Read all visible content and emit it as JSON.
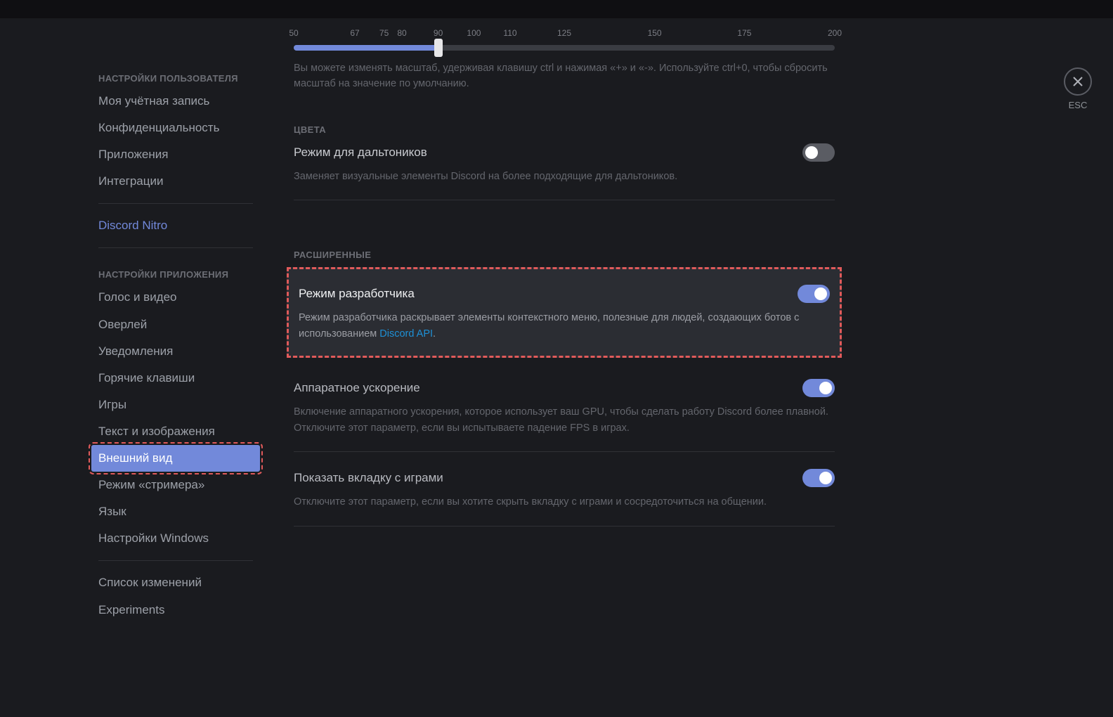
{
  "close_label": "ESC",
  "sidebar": {
    "user_heading": "НАСТРОЙКИ ПОЛЬЗОВАТЕЛЯ",
    "user_items": [
      "Моя учётная запись",
      "Конфиденциальность",
      "Приложения",
      "Интеграции"
    ],
    "nitro": "Discord Nitro",
    "app_heading": "НАСТРОЙКИ ПРИЛОЖЕНИЯ",
    "app_items": [
      "Голос и видео",
      "Оверлей",
      "Уведомления",
      "Горячие клавиши",
      "Игры",
      "Текст и изображения",
      "Внешний вид",
      "Режим «стримера»",
      "Язык",
      "Настройки Windows"
    ],
    "bottom_items": [
      "Список изменений",
      "Experiments"
    ]
  },
  "slider": {
    "ticks": [
      "50",
      "67",
      "75",
      "80",
      "90",
      "100",
      "110",
      "125",
      "150",
      "175",
      "200"
    ],
    "positions_pct": [
      0,
      11.3,
      16.7,
      20,
      26.7,
      33.3,
      40,
      50,
      66.7,
      83.3,
      100
    ],
    "value_pct": 26.7,
    "help": "Вы можете изменять масштаб, удерживая клавишу ctrl и нажимая «+» и «-». Используйте ctrl+0, чтобы сбросить масштаб на значение по умолчанию."
  },
  "colors": {
    "heading": "ЦВЕТА",
    "colorblind_label": "Режим для дальтоников",
    "colorblind_desc": "Заменяет визуальные элементы Discord на более подходящие для дальтоников."
  },
  "advanced": {
    "heading": "РАСШИРЕННЫЕ",
    "dev_label": "Режим разработчика",
    "dev_desc_prefix": "Режим разработчика раскрывает элементы контекстного меню, полезные для людей, создающих ботов с использованием ",
    "dev_link": "Discord API",
    "dev_desc_suffix": ".",
    "hw_label": "Аппаратное ускорение",
    "hw_desc": "Включение аппаратного ускорения, которое использует ваш GPU, чтобы сделать работу Discord более плавной. Отключите этот параметр, если вы испытываете падение FPS в играх.",
    "games_label": "Показать вкладку с играми",
    "games_desc": "Отключите этот параметр, если вы хотите скрыть вкладку с играми и сосредоточиться на общении."
  }
}
